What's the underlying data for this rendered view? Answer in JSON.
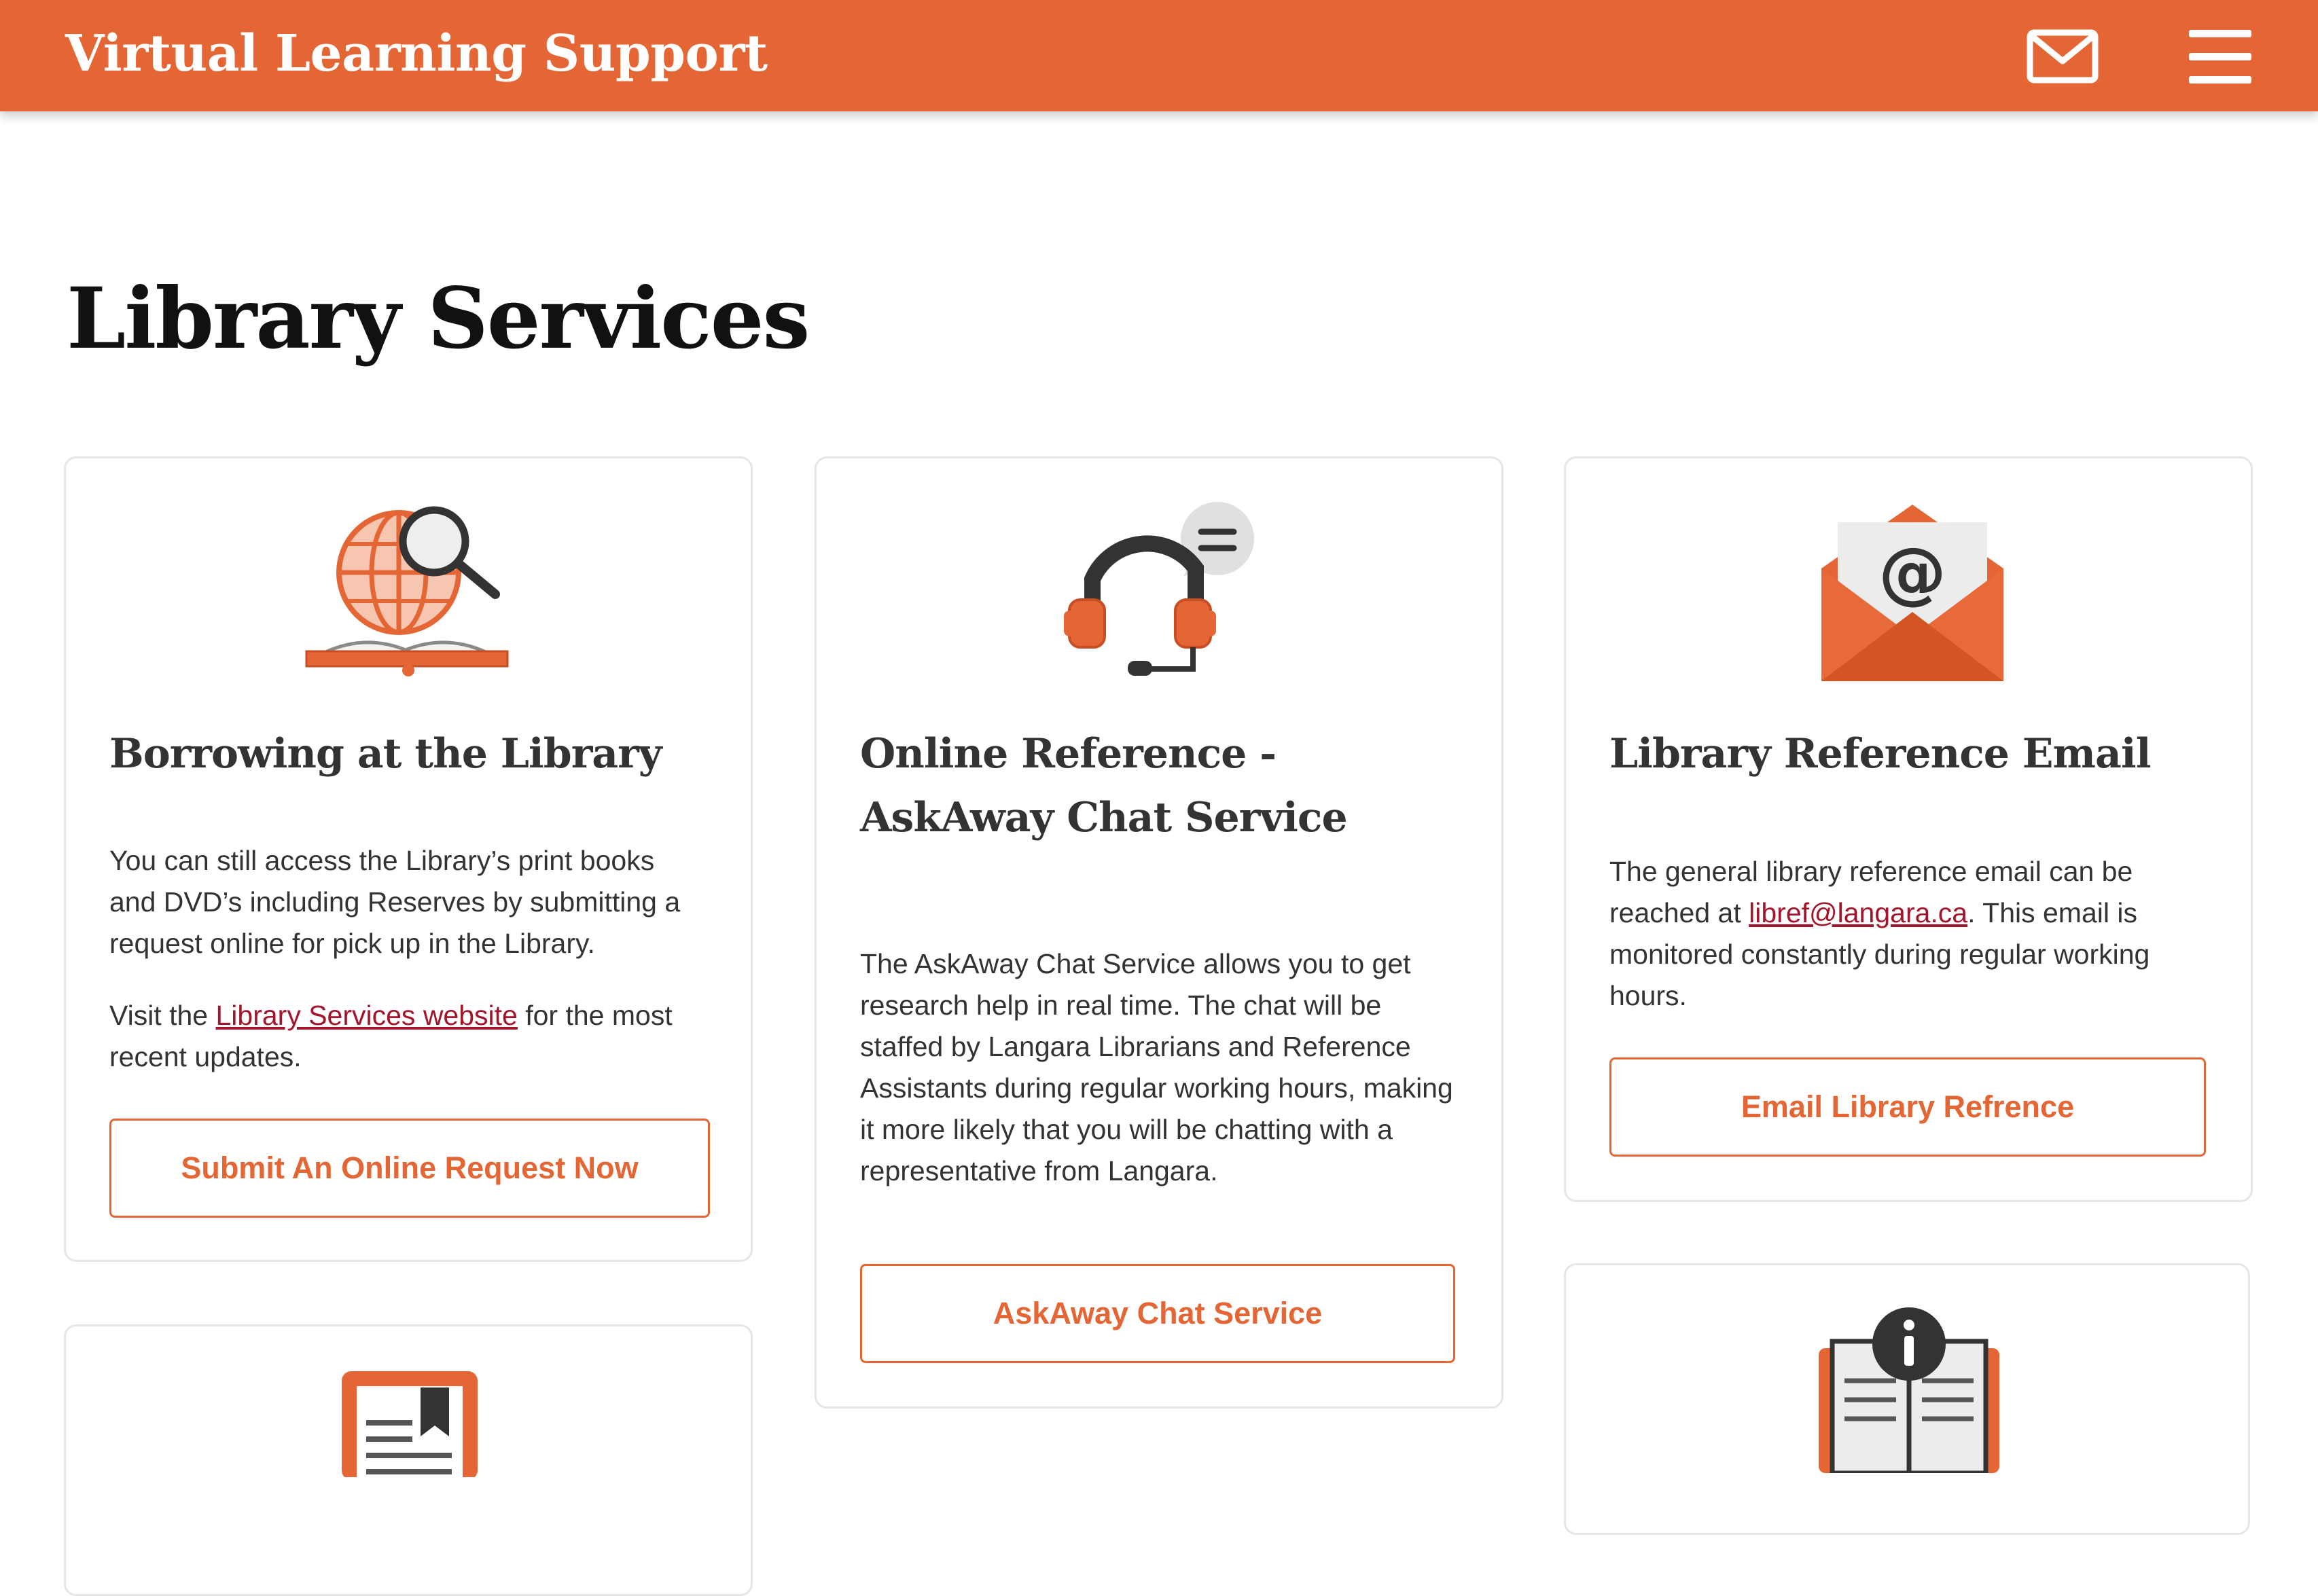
{
  "header": {
    "title": "Virtual Learning Support",
    "icons": {
      "mail": "mail-icon",
      "menu": "hamburger-menu-icon"
    },
    "colors": {
      "brand": "#e56635",
      "text": "#ffffff"
    }
  },
  "page": {
    "title": "Library Services"
  },
  "cards": {
    "borrowing": {
      "icon": "globe-search-book-icon",
      "title": "Borrowing at the Library",
      "paragraph1": "You can still access the Library’s print books and DVD’s including Reserves by submitting a request online for pick up in the Library.",
      "paragraph2_prefix": "Visit the ",
      "paragraph2_link": "Library Services website",
      "paragraph2_suffix": " for the most recent updates.",
      "button": "Submit An Online Request Now"
    },
    "askaway": {
      "icon": "headset-chat-icon",
      "title": "Online Reference - AskAway Chat Service",
      "paragraph": "The AskAway Chat Service allows you to get research help in real time. The chat will be staffed by Langara Librarians and Reference Assistants during regular working hours, making it more likely that you will be chatting with a representative from Langara.",
      "button": "AskAway Chat Service"
    },
    "email": {
      "icon": "email-envelope-at-icon",
      "title": "Library Reference Email",
      "paragraph_prefix": "The general library reference email can be reached at ",
      "paragraph_link": "libref@langara.ca",
      "paragraph_suffix": ". This email is monitored constantly during regular working hours.",
      "button": "Email Library Refrence"
    },
    "card4": {
      "icon": "document-bookmark-icon"
    },
    "card5": {
      "icon": "book-info-icon"
    }
  },
  "colors": {
    "accent": "#e56635",
    "link": "#a3152a",
    "text": "#333333",
    "card_border": "#e6e6e6"
  }
}
